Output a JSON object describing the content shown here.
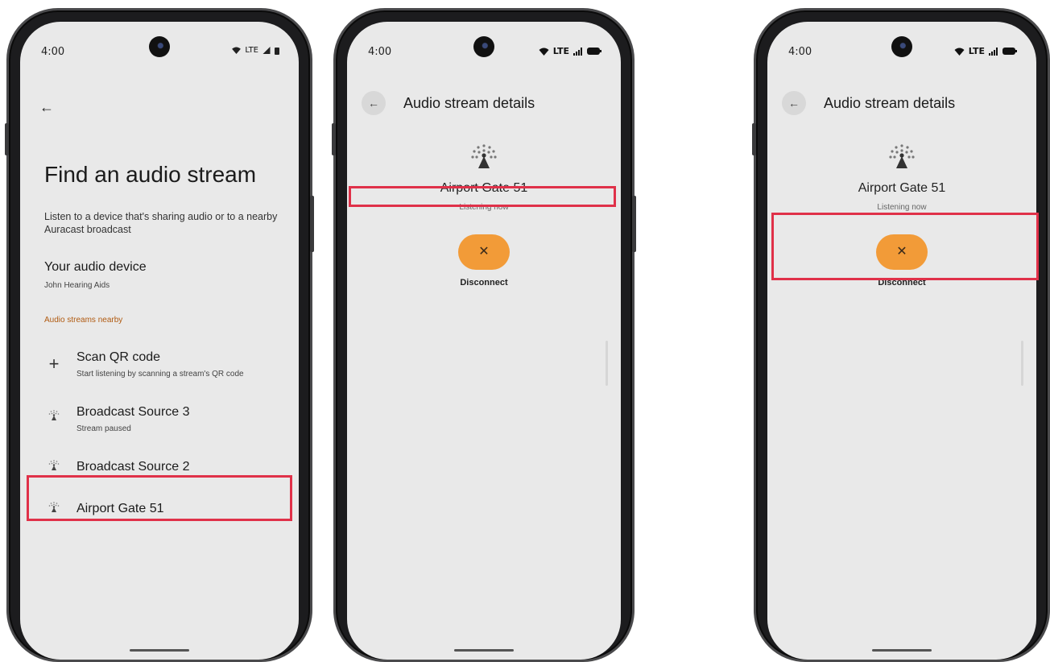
{
  "status_bar": {
    "time": "4:00",
    "network": "LTE"
  },
  "screen1": {
    "title": "Find an audio stream",
    "description": "Listen to a device that's sharing audio or to a nearby Auracast broadcast",
    "device_title": "Your audio device",
    "device_name": "John Hearing Aids",
    "section_label": "Audio streams nearby",
    "items": [
      {
        "label": "Scan QR code",
        "sublabel": "Start listening by scanning a stream's QR code",
        "icon": "plus-icon"
      },
      {
        "label": "Broadcast Source 3",
        "sublabel": "Stream paused",
        "icon": "broadcast-icon"
      },
      {
        "label": "Broadcast Source 2",
        "sublabel": "",
        "icon": "broadcast-icon"
      },
      {
        "label": "Airport Gate 51",
        "sublabel": "",
        "icon": "broadcast-icon"
      }
    ]
  },
  "screen2": {
    "title": "Audio stream details",
    "stream_name": "Airport Gate 51",
    "status": "Listening now",
    "disconnect_label": "Disconnect"
  },
  "screen3": {
    "title": "Audio stream details",
    "stream_name": "Airport Gate 51",
    "status": "Listening now",
    "disconnect_label": "Disconnect"
  },
  "colors": {
    "highlight": "#e03149",
    "accent": "#f29b38",
    "section_text": "#b05a10"
  }
}
